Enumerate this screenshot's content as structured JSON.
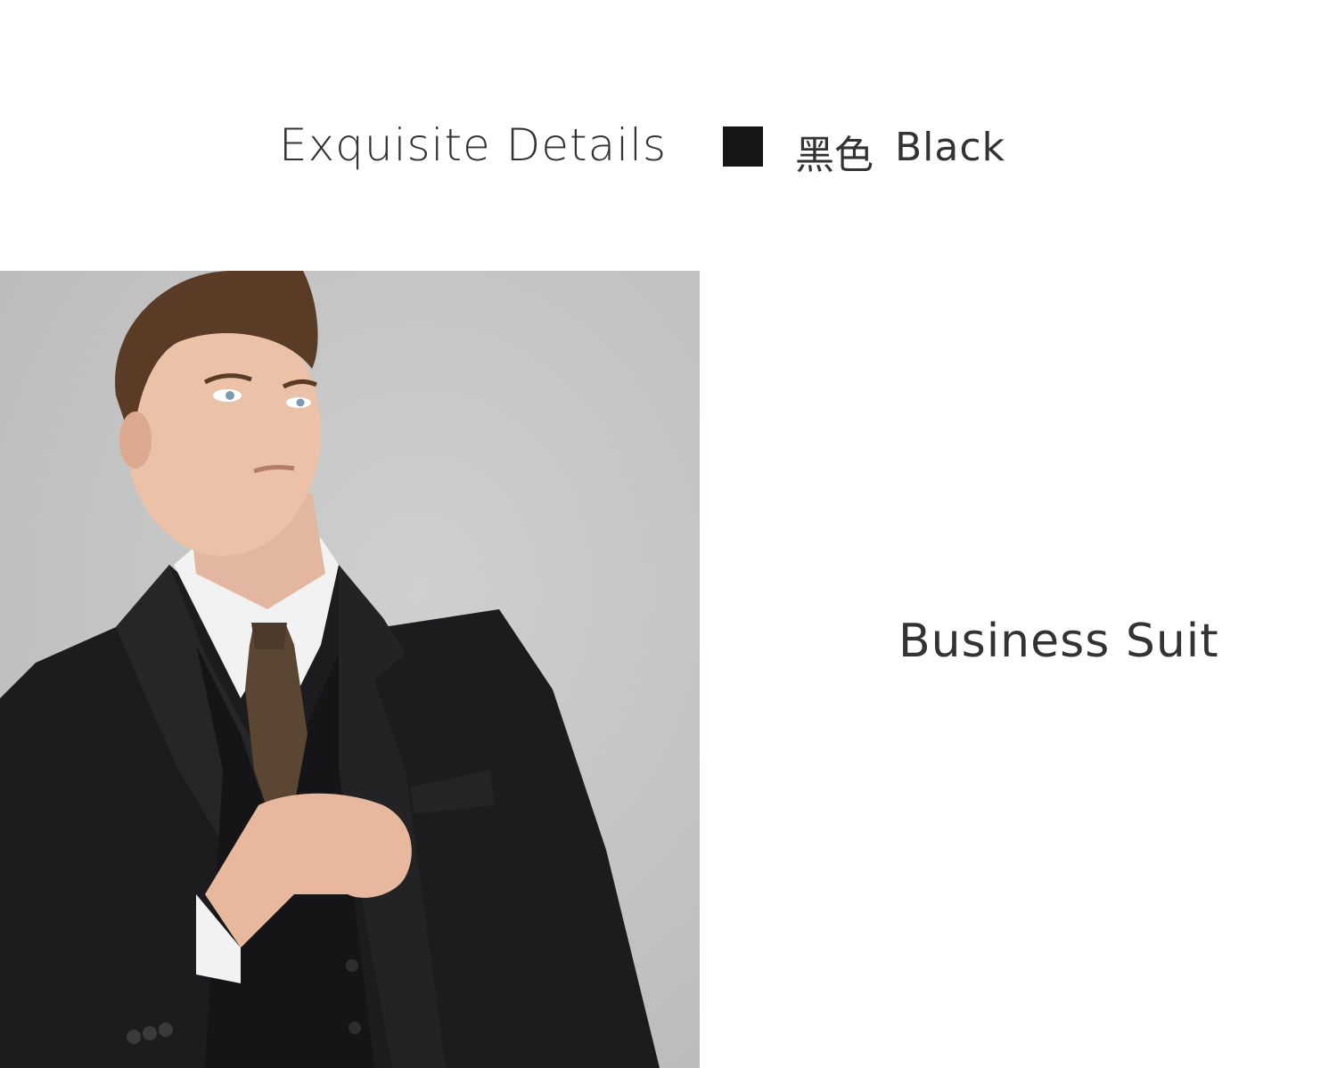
{
  "header": {
    "title": "Exquisite Details",
    "color_cn": "黑色",
    "color_en": "Black",
    "swatch_color": "#161616"
  },
  "product": {
    "label": "Business Suit"
  },
  "photo": {
    "subject": "model-in-black-suit-image",
    "background_color": "#c4c4c4"
  }
}
